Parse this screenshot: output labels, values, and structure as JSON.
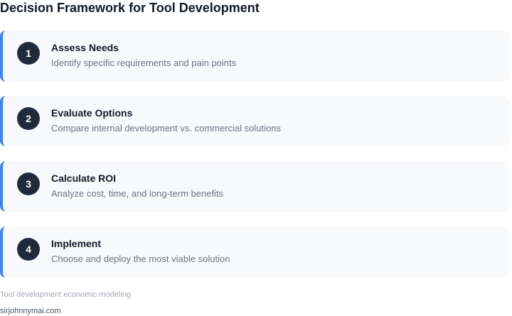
{
  "title": "Decision Framework for Tool Development",
  "steps": [
    {
      "number": "1",
      "title": "Assess Needs",
      "description": "Identify specific requirements and pain points"
    },
    {
      "number": "2",
      "title": "Evaluate Options",
      "description": "Compare internal development vs. commercial solutions"
    },
    {
      "number": "3",
      "title": "Calculate ROI",
      "description": "Analyze cost, time, and long-term benefits"
    },
    {
      "number": "4",
      "title": "Implement",
      "description": "Choose and deploy the most viable solution"
    }
  ],
  "caption": "Tool development economic modeling",
  "source": "sirjohnnymai.com",
  "colors": {
    "accent": "#3b82f6",
    "badge": "#1f2a3d",
    "card_background": "#f8f9fb"
  }
}
